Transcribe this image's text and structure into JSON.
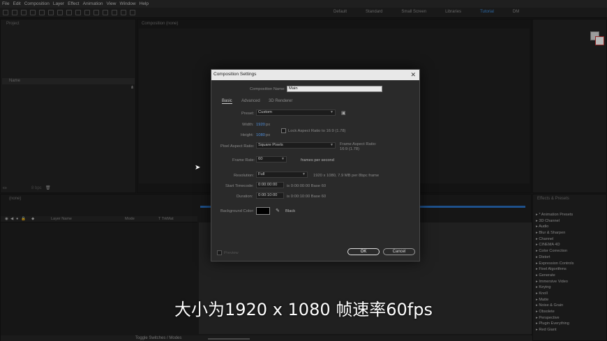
{
  "menu": [
    "File",
    "Edit",
    "Composition",
    "Layer",
    "Effect",
    "Animation",
    "View",
    "Window",
    "Help"
  ],
  "workspaces": [
    "Default",
    "Standard",
    "Small Screen",
    "Libraries",
    "Tutorial",
    "DM"
  ],
  "active_workspace": "Tutorial",
  "project": {
    "tab": "Project",
    "column_name": "Name",
    "bpc": "8 bpc"
  },
  "composition_panel": {
    "tab": "Composition (none)"
  },
  "timeline": {
    "tab": "(none)",
    "col_layer_name": "Layer Name",
    "col_mode": "Mode",
    "col_trkmat": "T TrkMat",
    "toggle_label": "Toggle Switches / Modes"
  },
  "effects": {
    "tab": "Effects & Presets",
    "items": [
      "* Animation Presets",
      "3D Channel",
      "Audio",
      "Blur & Sharpen",
      "Channel",
      "CINEMA 4D",
      "Color Correction",
      "Distort",
      "Expression Controls",
      "Fixel Algorithms",
      "Generate",
      "Immersive Video",
      "Keying",
      "Knoll",
      "Matte",
      "Noise & Grain",
      "Obsolete",
      "Perspective",
      "Plugin Everything",
      "Red Giant"
    ]
  },
  "dialog": {
    "title": "Composition Settings",
    "name_label": "Composition Name:",
    "name_value": "Main",
    "tabs": [
      "Basic",
      "Advanced",
      "3D Renderer"
    ],
    "preset_label": "Preset:",
    "preset_value": "Custom",
    "width_label": "Width:",
    "width_value": "1920",
    "width_unit": "px",
    "height_label": "Height:",
    "height_value": "1080",
    "height_unit": "px",
    "lock_label": "Lock Aspect Ratio to 16:9 (1.78)",
    "par_label": "Pixel Aspect Ratio:",
    "par_value": "Square Pixels",
    "frame_aspect_label": "Frame Aspect Ratio:",
    "frame_aspect_value": "16:9 (1.78)",
    "framerate_label": "Frame Rate:",
    "framerate_value": "60",
    "framerate_unit": "frames per second",
    "resolution_label": "Resolution:",
    "resolution_value": "Full",
    "resolution_info": "1920 x 1080, 7.9 MB per 8bpc frame",
    "start_tc_label": "Start Timecode:",
    "start_tc_value": "0:00:00:00",
    "start_tc_info": "is 0:00:00:00  Base 60",
    "duration_label": "Duration:",
    "duration_value": "0:00:10:00",
    "duration_info": "is 0:00:10:00  Base 60",
    "bg_label": "Background Color:",
    "bg_name": "Black",
    "bg_color": "#000000",
    "preview_label": "Preview",
    "ok_label": "OK",
    "cancel_label": "Cancel"
  },
  "subtitle": "大小为1920 x 1080 帧速率60fps",
  "colors": {
    "accent": "#3d8fe0",
    "panel": "#232323",
    "dialog": "#2a2a2a"
  }
}
